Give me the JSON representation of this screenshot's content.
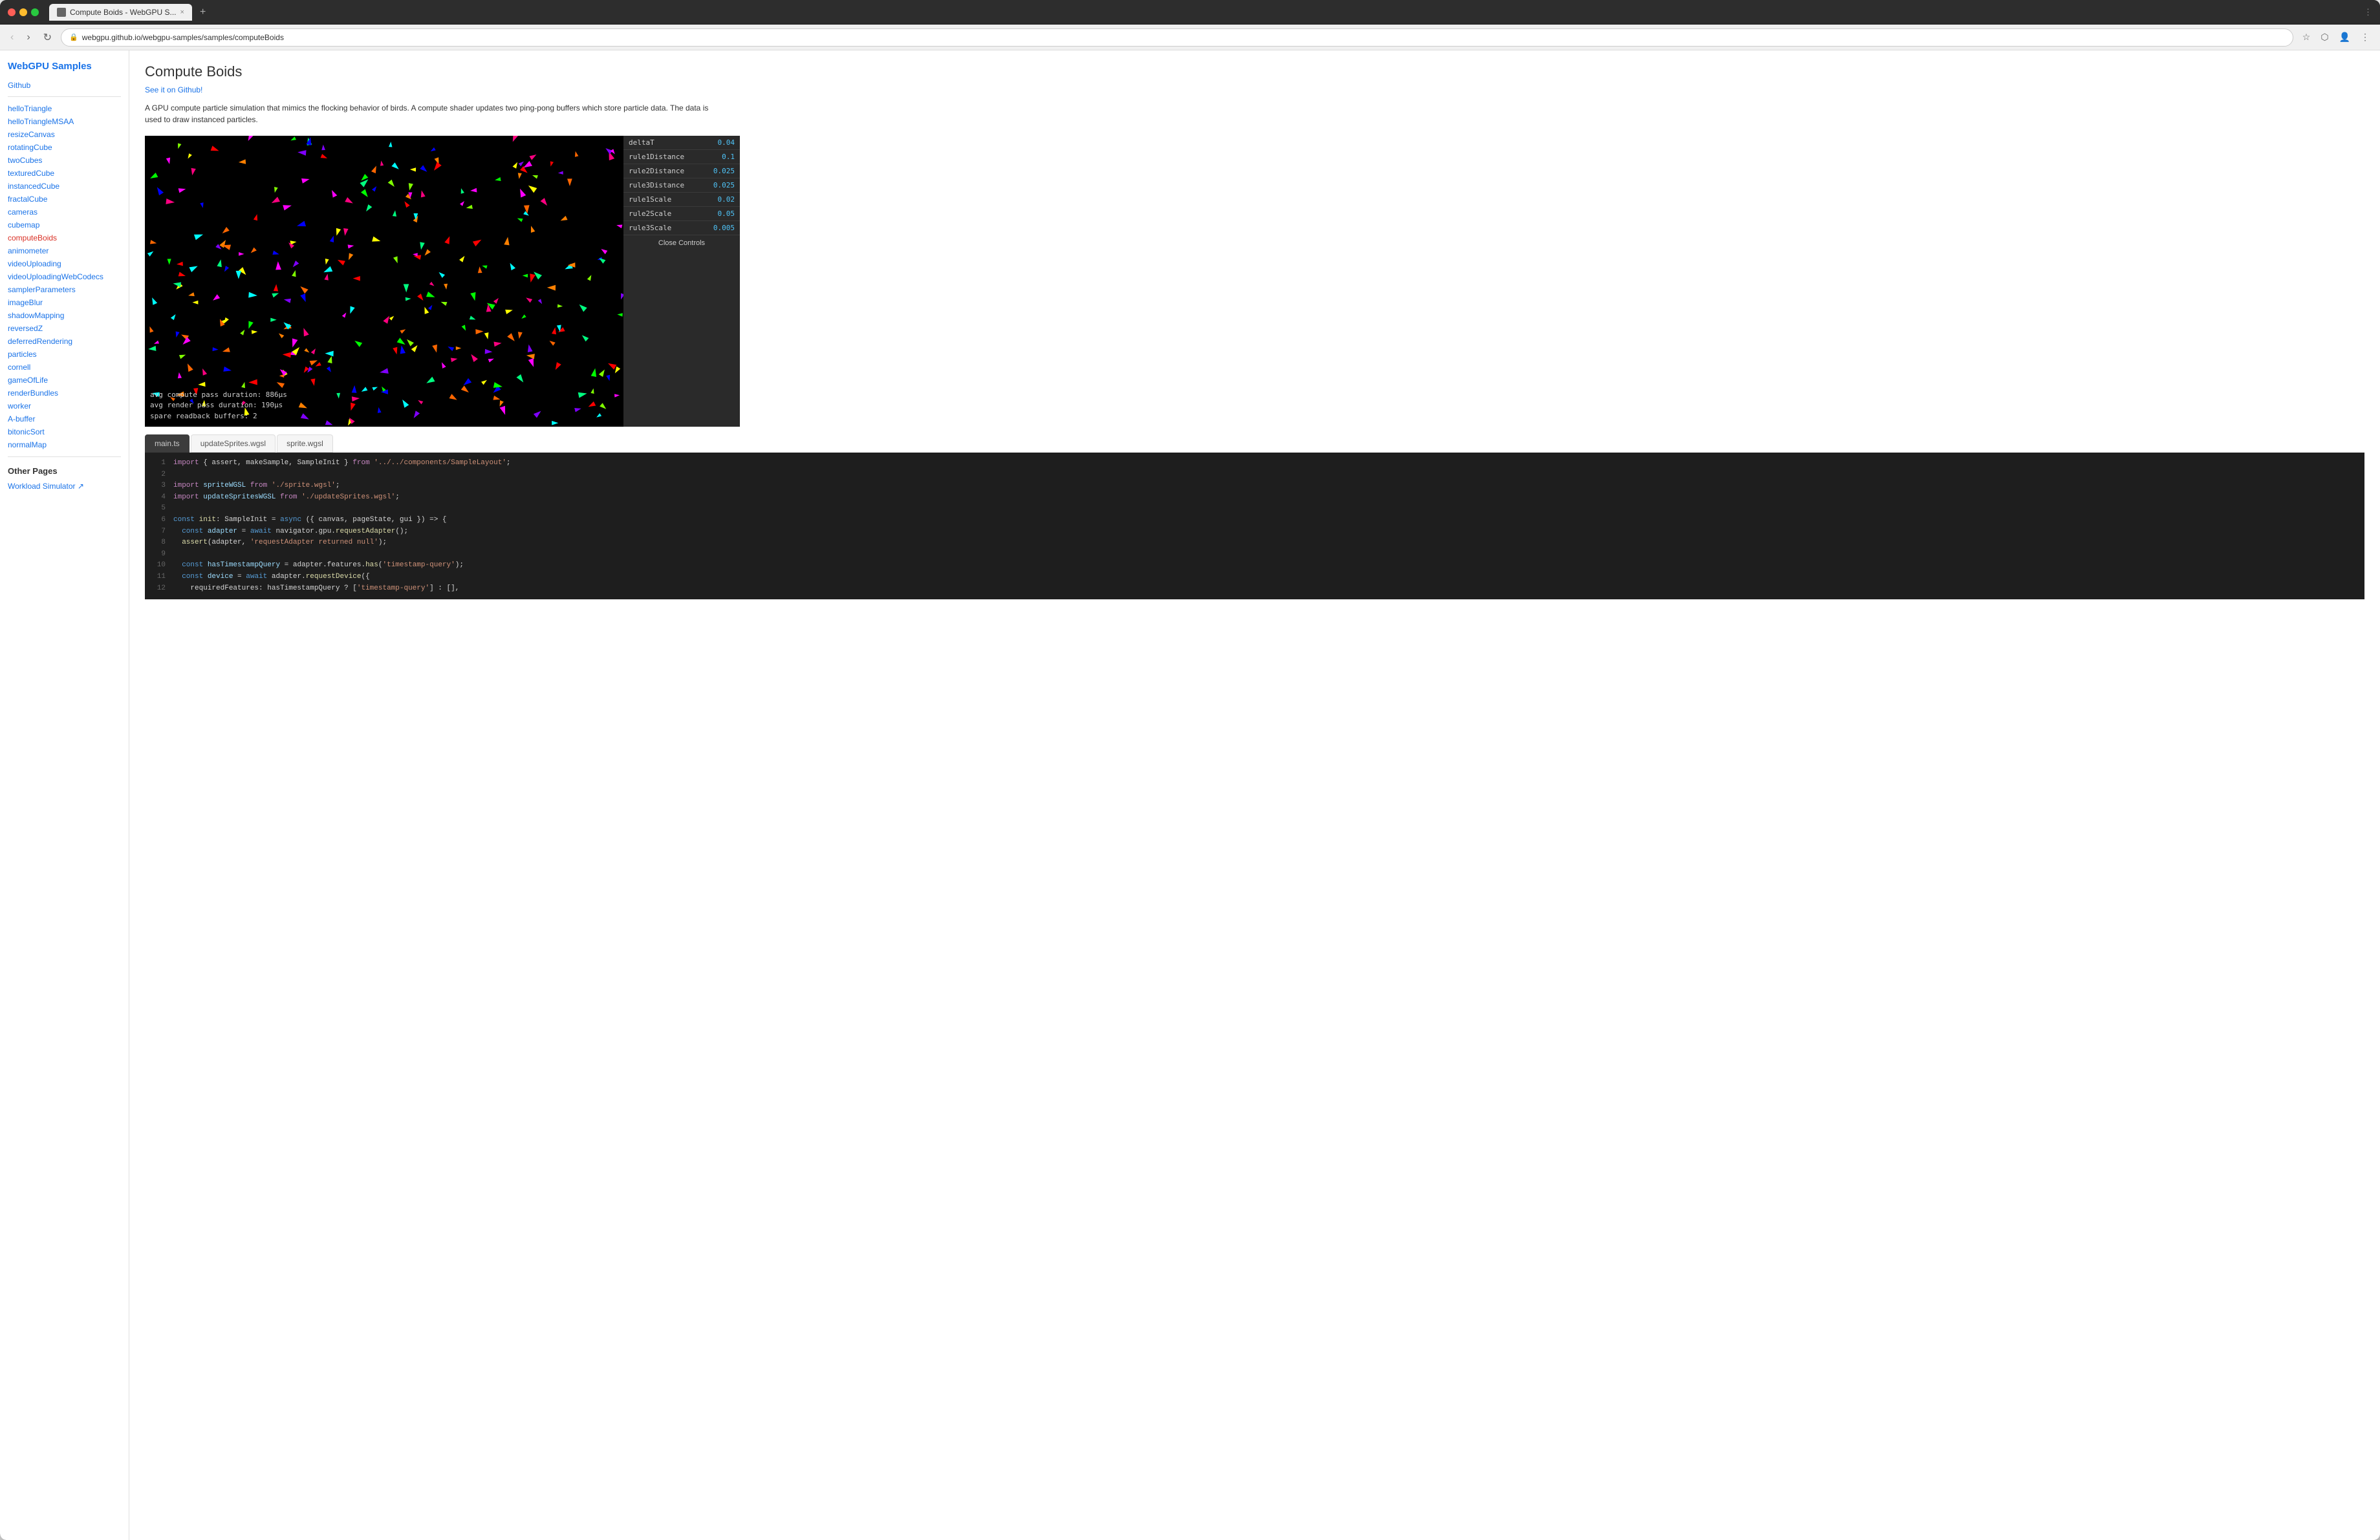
{
  "browser": {
    "tab_title": "Compute Boids - WebGPU S...",
    "url": "webgpu.github.io/webgpu-samples/samples/computeBoids",
    "new_tab_label": "+",
    "close_label": "×"
  },
  "nav": {
    "back_label": "‹",
    "forward_label": "›",
    "reload_label": "↻"
  },
  "sidebar": {
    "title": "WebGPU Samples",
    "github_label": "Github",
    "nav_items": [
      {
        "label": "helloTriangle",
        "active": false
      },
      {
        "label": "helloTriangleMSAA",
        "active": false
      },
      {
        "label": "resizeCanvas",
        "active": false
      },
      {
        "label": "rotatingCube",
        "active": false
      },
      {
        "label": "twoCubes",
        "active": false
      },
      {
        "label": "texturedCube",
        "active": false
      },
      {
        "label": "instancedCube",
        "active": false
      },
      {
        "label": "fractalCube",
        "active": false
      },
      {
        "label": "cameras",
        "active": false
      },
      {
        "label": "cubemap",
        "active": false
      },
      {
        "label": "computeBoids",
        "active": true
      },
      {
        "label": "animometer",
        "active": false
      },
      {
        "label": "videoUploading",
        "active": false
      },
      {
        "label": "videoUploadingWebCodecs",
        "active": false
      },
      {
        "label": "samplerParameters",
        "active": false
      },
      {
        "label": "imageBlur",
        "active": false
      },
      {
        "label": "shadowMapping",
        "active": false
      },
      {
        "label": "reversedZ",
        "active": false
      },
      {
        "label": "deferredRendering",
        "active": false
      },
      {
        "label": "particles",
        "active": false
      },
      {
        "label": "cornell",
        "active": false
      },
      {
        "label": "gameOfLife",
        "active": false
      },
      {
        "label": "renderBundles",
        "active": false
      },
      {
        "label": "worker",
        "active": false
      },
      {
        "label": "A-buffer",
        "active": false
      },
      {
        "label": "bitonicSort",
        "active": false
      },
      {
        "label": "normalMap",
        "active": false
      }
    ],
    "other_pages_title": "Other Pages",
    "other_pages_items": [
      {
        "label": "Workload Simulator ↗"
      }
    ]
  },
  "main": {
    "title": "Compute Boids",
    "github_link": "See it on Github!",
    "description": "A GPU compute particle simulation that mimics the flocking behavior of birds. A compute shader updates two ping-pong buffers which store particle data. The data is used to draw instanced particles.",
    "stats": {
      "line1": "avg compute pass duration:  886µs",
      "line2": "avg render pass duration:   190µs",
      "line3": "spare readback buffers:      2"
    },
    "controls": {
      "rows": [
        {
          "label": "deltaT",
          "value": "0.04"
        },
        {
          "label": "rule1Distance",
          "value": "0.1"
        },
        {
          "label": "rule2Distance",
          "value": "0.025"
        },
        {
          "label": "rule3Distance",
          "value": "0.025"
        },
        {
          "label": "rule1Scale",
          "value": "0.02"
        },
        {
          "label": "rule2Scale",
          "value": "0.05"
        },
        {
          "label": "rule3Scale",
          "value": "0.005"
        }
      ],
      "close_label": "Close Controls"
    },
    "code_tabs": [
      {
        "label": "main.ts",
        "active": true
      },
      {
        "label": "updateSprites.wgsl",
        "active": false
      },
      {
        "label": "sprite.wgsl",
        "active": false
      }
    ],
    "code_lines": [
      {
        "num": "1",
        "html": "<span class='c-import'>import</span> <span class='c-operator'>{ assert, makeSample, SampleInit }</span> <span class='c-import'>from</span> <span class='c-string'>'../../components/SampleLayout'</span><span>;</span>"
      },
      {
        "num": "2",
        "html": ""
      },
      {
        "num": "3",
        "html": "<span class='c-import'>import</span> <span class='c-var'>spriteWGSL</span> <span class='c-import'>from</span> <span class='c-string'>'./sprite.wgsl'</span><span>;</span>"
      },
      {
        "num": "4",
        "html": "<span class='c-import'>import</span> <span class='c-var'>updateSpritesWGSL</span> <span class='c-import'>from</span> <span class='c-string'>'./updateSprites.wgsl'</span><span>;</span>"
      },
      {
        "num": "5",
        "html": ""
      },
      {
        "num": "6",
        "html": "<span class='c-keyword'>const</span> <span class='c-func'>init</span><span>: SampleInit = </span><span class='c-keyword'>async</span> <span>({ canvas, pageState, gui }) => {</span>"
      },
      {
        "num": "7",
        "html": "  <span class='c-keyword'>const</span> <span class='c-var'>adapter</span> <span>= </span><span class='c-keyword'>await</span> <span>navigator.gpu.</span><span class='c-func'>requestAdapter</span><span>();</span>"
      },
      {
        "num": "8",
        "html": "  <span class='c-func'>assert</span><span>(adapter, </span><span class='c-string'>'requestAdapter returned null'</span><span>);</span>"
      },
      {
        "num": "9",
        "html": ""
      },
      {
        "num": "10",
        "html": "  <span class='c-keyword'>const</span> <span class='c-var'>hasTimestampQuery</span> <span>= adapter.features.</span><span class='c-func'>has</span><span>(</span><span class='c-string'>'timestamp-query'</span><span>);</span>"
      },
      {
        "num": "11",
        "html": "  <span class='c-keyword'>const</span> <span class='c-var'>device</span> <span>= </span><span class='c-keyword'>await</span> <span>adapter.</span><span class='c-func'>requestDevice</span><span>({</span>"
      },
      {
        "num": "12",
        "html": "    requiredFeatures: hasTimestampQuery ? [<span class='c-string'>'timestamp-query'</span>] : [],"
      }
    ]
  },
  "colors": {
    "accent": "#1a73e8",
    "active_nav": "#d93025",
    "code_bg": "#1e1e1e",
    "canvas_bg": "#000000"
  }
}
